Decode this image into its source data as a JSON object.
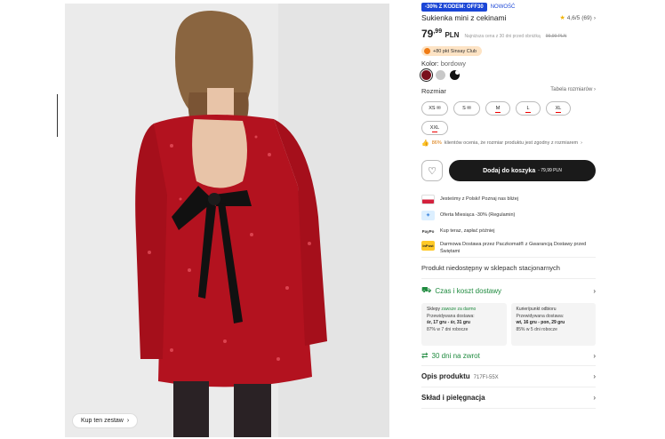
{
  "product": {
    "badge_promo": "-30% Z KODEM: OFF30",
    "badge_new": "NOWOŚĆ",
    "title": "Sukienka mini z cekinami",
    "rating": "4,6/5",
    "rating_count": "(69)",
    "price_int": "79",
    "price_dec": ",99",
    "price_currency": "PLN",
    "price_note": "Najniższa cena z 30 dni przed obniżką",
    "price_old": "99,99 PLN",
    "club_text": "+80 pkt Sinsay Club",
    "color_label": "Kolor:",
    "color_value": "bordowy",
    "swatches": [
      "#7a0f1c",
      "#c8c8c8",
      "#111111"
    ],
    "size_label": "Rozmiar",
    "size_table": "Tabela rozmiarów",
    "sizes": [
      "XS",
      "S",
      "M",
      "L",
      "XL",
      "XXL"
    ],
    "fit_pct": "86%",
    "fit_text": "klientów ocenia, że rozmiar produktu jest zgodny z rozmiarem",
    "add_to_cart": "Dodaj do koszyka",
    "add_to_cart_price": "- 79,99 PLN",
    "shop_set": "Kup ten zestaw"
  },
  "perks": [
    {
      "icon": "poland-flag-icon",
      "text": "Jesteśmy z Polski! Poznaj nas bliżej"
    },
    {
      "icon": "offer-icon",
      "text": "Oferta Miesiąca -30% (Regulamin)"
    },
    {
      "icon": "paypo-icon",
      "icon_text": "PayPo",
      "text": "Kup teraz, zapłać później"
    },
    {
      "icon": "inpost-icon",
      "icon_text": "InPost",
      "text": "Darmowa Dostawa przez Paczkomat® z Gwarancją Dostawy przed Świętami"
    }
  ],
  "not_available": "Produkt niedostępny w sklepach stacjonarnych",
  "delivery": {
    "title": "Czas i koszt dostawy",
    "stores": {
      "heading": "Sklepy",
      "heading_free": "zawsze za darmo",
      "expected": "Przewidywana dostawa:",
      "dates": "śr, 17 gru - śr, 31 gru",
      "ontime": "87% w 7 dni robocze"
    },
    "courier": {
      "heading": "Kurier/punkt odbioru",
      "expected": "Przewidywana dostawa:",
      "dates": "wt, 16 gru - pon, 29 gru",
      "ontime": "85% w 5 dni robocze"
    }
  },
  "returns": "30 dni na zwrot",
  "description": {
    "title": "Opis produktu",
    "code": "717FI-55X"
  },
  "composition": "Skład i pielęgnacja",
  "colors": {
    "accent_green": "#1e8a3e",
    "promo_blue": "#1b46d6",
    "button_dark": "#1a1a1a"
  }
}
